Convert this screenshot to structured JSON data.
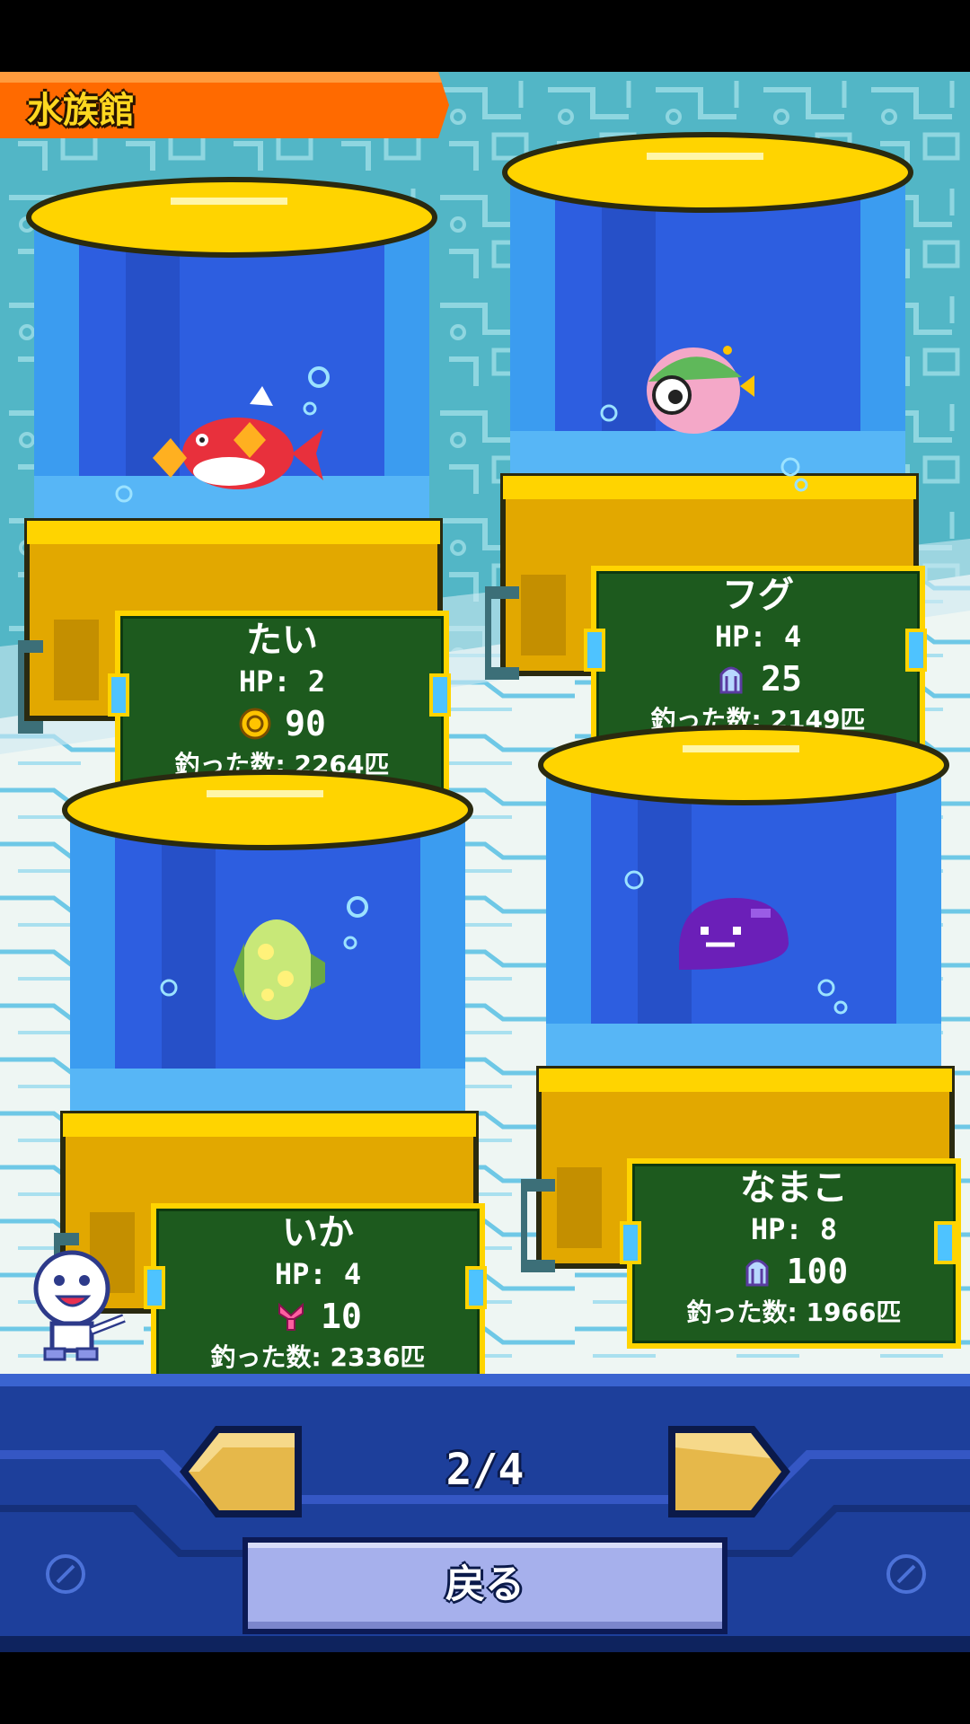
{
  "screen": {
    "title": "水族館"
  },
  "tanks": [
    {
      "name": "たい",
      "hp": "HP: 2",
      "reward_icon": "coin-icon",
      "reward_value": "90",
      "caught": "釣った数: 2264匹",
      "creature": "red-snapper-fish"
    },
    {
      "name": "フグ",
      "hp": "HP: 4",
      "reward_icon": "crystal-icon",
      "reward_value": "25",
      "caught": "釣った数: 2149匹",
      "creature": "pufferfish"
    },
    {
      "name": "いか",
      "hp": "HP: 4",
      "reward_icon": "ribbon-icon",
      "reward_value": "10",
      "caught": "釣った数: 2336匹",
      "creature": "green-squid"
    },
    {
      "name": "なまこ",
      "hp": "HP: 8",
      "reward_icon": "crystal-icon",
      "reward_value": "100",
      "caught": "釣った数: 1966匹",
      "creature": "purple-sea-cucumber"
    }
  ],
  "pagination": {
    "current": 2,
    "total": 4,
    "label": "2/4"
  },
  "buttons": {
    "back_label": "戻る",
    "prev_icon": "left-arrow-icon",
    "next_icon": "right-arrow-icon"
  },
  "colors": {
    "banner": "#ff6a00",
    "title_text": "#ffd820",
    "panel_bg": "#1d5a1e",
    "panel_border": "#ffd400",
    "nav_bg": "#1d3f9b",
    "arrow": "#e6b84a",
    "back_button": "#a6b0ec"
  }
}
